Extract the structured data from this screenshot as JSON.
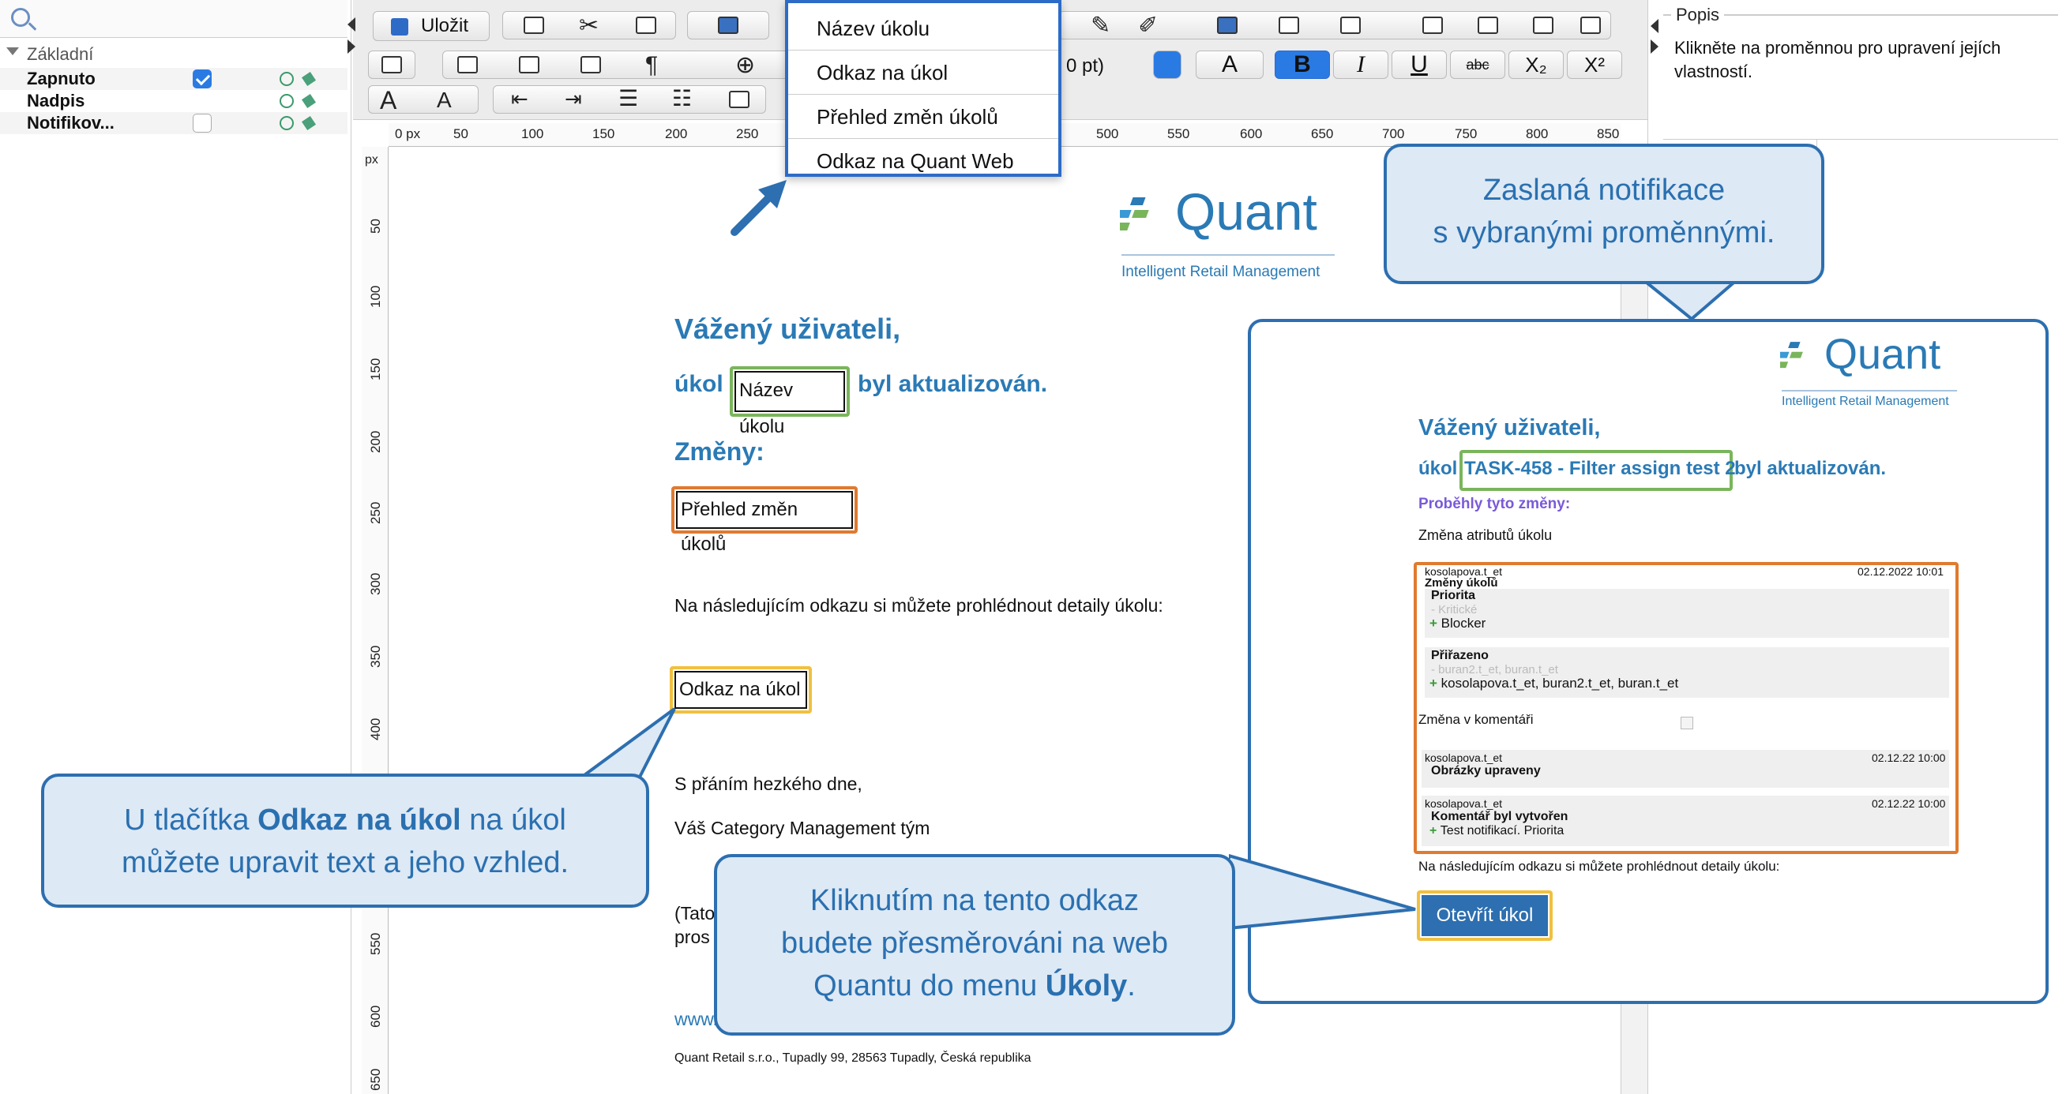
{
  "left_panel": {
    "group_label": "Základní",
    "items": [
      {
        "label": "Zapnuto",
        "checked": true
      },
      {
        "label": "Nadpis",
        "checked": null
      },
      {
        "label": "Notifikov...",
        "checked": false
      }
    ]
  },
  "toolbar": {
    "save_label": "Uložit",
    "font_size_suffix": "0 pt)",
    "format_buttons": [
      "A",
      "B",
      "I",
      "U",
      "abc",
      "X₂",
      "X²"
    ]
  },
  "dropdown": {
    "items": [
      "Název úkolu",
      "Odkaz na úkol",
      "Přehled změn úkolů",
      "Odkaz na Quant Web"
    ]
  },
  "right_panel": {
    "title": "Popis",
    "text": "Klikněte na proměnnou pro upravení jejích vlastností."
  },
  "ruler": {
    "unit": "px",
    "top_ticks": [
      "0 px",
      "50",
      "100",
      "150",
      "200",
      "250",
      "500",
      "550",
      "600",
      "650",
      "700",
      "750",
      "800",
      "850"
    ],
    "left_ticks": [
      "50",
      "100",
      "150",
      "200",
      "250",
      "300",
      "350",
      "400",
      "550",
      "600",
      "650"
    ]
  },
  "template": {
    "logo_name": "Quant",
    "logo_subtitle": "Intelligent Retail Management",
    "greeting": "Vážený uživateli,",
    "task_prefix": "úkol",
    "task_field": "Název úkolu",
    "task_suffix": "byl aktualizován.",
    "changes_heading": "Změny:",
    "changes_field": "Přehled změn úkolů",
    "link_text": "Na následujícím odkazu si můžete prohlédnout detaily úkolu:",
    "link_field": "Odkaz na úkol",
    "closing": "S přáním hezkého dne,",
    "signature": "Váš Category Management tým",
    "partial_1": "(Tato",
    "partial_2": "pros",
    "partial_www": "www.",
    "footer": "Quant Retail s.r.o., Tupadly 99, 28563 Tupadly, Česká republika"
  },
  "callouts": {
    "top_right": [
      "Zaslaná notifikace",
      "s vybranými proměnnými."
    ],
    "left_prefix": "U tlačítka ",
    "left_bold": "Odkaz na úkol",
    "left_suffix": " na úkol",
    "left_line2": "můžete upravit text a jeho vzhled.",
    "bottom_line1": "Kliknutím na tento odkaz",
    "bottom_line2": "budete přesměrováni na web",
    "bottom_prefix": "Quantu do menu ",
    "bottom_bold": "Úkoly",
    "bottom_suffix": "."
  },
  "preview": {
    "logo_name": "Quant",
    "logo_subtitle": "Intelligent Retail Management",
    "greeting": "Vážený uživateli,",
    "task_prefix": "úkol",
    "task_name": "TASK-458 - Filter assign test 2",
    "task_suffix": "byl aktualizován.",
    "changes_heading": "Proběhly tyto změny:",
    "attr_change_label": "Změna atributů úkolu",
    "entry1": {
      "user": "kosolapova.t_et",
      "date": "02.12.2022 10:01",
      "title": "Změny úkolů"
    },
    "priority": {
      "label": "Priorita",
      "old": "- Kritické",
      "new": "Blocker"
    },
    "assigned": {
      "label": "Přiřazeno",
      "old": "- buran2.t_et, buran.t_et",
      "new": "kosolapova.t_et, buran2.t_et, buran.t_et"
    },
    "comment_change_label": "Změna v komentáři",
    "entry2": {
      "user": "kosolapova.t_et",
      "date": "02.12.22 10:00",
      "title": "Obrázky upraveny"
    },
    "entry3": {
      "user": "kosolapova.t_et",
      "date": "02.12.22 10:00",
      "title": "Komentář byl vytvořen",
      "detail": "Test notifikací. Priorita"
    },
    "link_text": "Na následujícím odkazu si můžete prohlédnout detaily úkolu:",
    "button_label": "Otevřít úkol"
  },
  "colors": {
    "accent_blue": "#2a7ab5",
    "callout_border": "#2d6fb0",
    "callout_fill": "#dde9f5",
    "green_frame": "#7ab55c",
    "orange_frame": "#e07a30",
    "yellow_frame": "#f0c040",
    "purple_heading": "#7a5ad8"
  }
}
